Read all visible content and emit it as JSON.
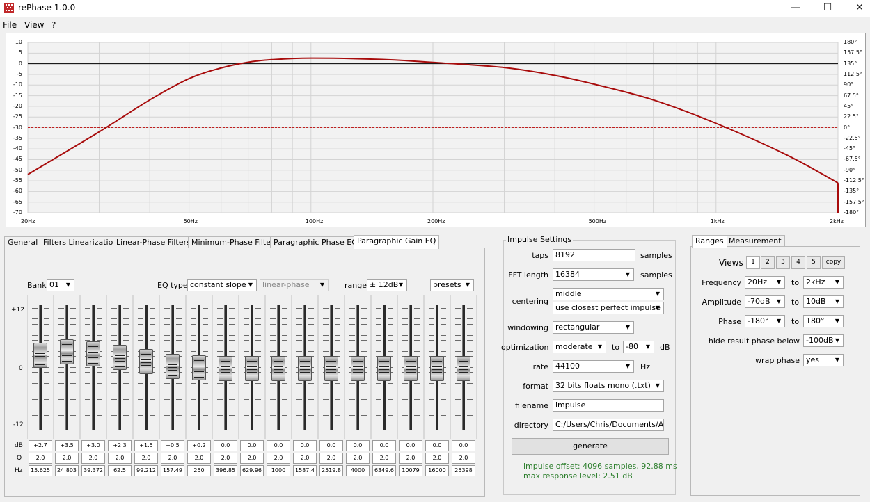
{
  "window": {
    "title": "rePhase 1.0.0",
    "minimize": "—",
    "maximize": "☐",
    "close": "✕"
  },
  "menu": [
    "File",
    "View",
    "?"
  ],
  "plot": {
    "y_left_ticks": [
      "10",
      "5",
      "0",
      "-5",
      "-10",
      "-15",
      "-20",
      "-25",
      "-30",
      "-35",
      "-40",
      "-45",
      "-50",
      "-55",
      "-60",
      "-65",
      "-70"
    ],
    "y_right_ticks": [
      "180°",
      "157.5°",
      "135°",
      "112.5°",
      "90°",
      "67.5°",
      "45°",
      "22.5°",
      "0°",
      "-22.5°",
      "-45°",
      "-67.5°",
      "-90°",
      "-112.5°",
      "-135°",
      "-157.5°",
      "-180°"
    ],
    "x_ticks": [
      "20Hz",
      "50Hz",
      "100Hz",
      "200Hz",
      "500Hz",
      "1kHz",
      "2kHz"
    ],
    "response_color": "#a80c0c",
    "phase_ref_color": "#c02020"
  },
  "chart_data": {
    "type": "line",
    "xlabel": "",
    "ylabel": "",
    "x_scale": "log",
    "xlim": [
      20,
      2000
    ],
    "ylim": [
      -70,
      10
    ],
    "y2lim": [
      -180,
      180
    ],
    "grid": true,
    "series": [
      {
        "x": [
          20,
          30,
          40,
          50,
          60,
          70,
          80,
          100,
          150,
          200,
          300,
          400,
          500,
          700,
          1000,
          1500,
          2000
        ],
        "values": [
          -52,
          -32,
          -17,
          -7,
          -2,
          0.7,
          1.9,
          2.6,
          2.0,
          0.6,
          -1.8,
          -5.5,
          -9.6,
          -17,
          -28,
          -43,
          -56
        ]
      }
    ],
    "zero_phase_line": 0
  },
  "tabs": [
    "General",
    "Filters Linearization",
    "Linear-Phase Filters",
    "Minimum-Phase Filters",
    "Paragraphic Phase EQ",
    "Paragraphic Gain EQ"
  ],
  "eq": {
    "bank_label": "Bank",
    "bank_value": "01",
    "eq_type_label": "EQ type",
    "eq_type_value": "constant slope",
    "eq_type2_value": "linear-phase",
    "range_label": "range",
    "range_value": "± 12dB",
    "presets_value": "presets",
    "scale_top": "+12",
    "scale_mid": "0",
    "scale_bottom": "-12",
    "row_db": "dB",
    "row_q": "Q",
    "row_hz": "Hz",
    "db": [
      "+2.7",
      "+3.5",
      "+3.0",
      "+2.3",
      "+1.5",
      "+0.5",
      "+0.2",
      "0.0",
      "0.0",
      "0.0",
      "0.0",
      "0.0",
      "0.0",
      "0.0",
      "0.0",
      "0.0",
      "0.0"
    ],
    "db_values": [
      2.7,
      3.5,
      3.0,
      2.3,
      1.5,
      0.5,
      0.2,
      0,
      0,
      0,
      0,
      0,
      0,
      0,
      0,
      0,
      0
    ],
    "q": [
      "2.0",
      "2.0",
      "2.0",
      "2.0",
      "2.0",
      "2.0",
      "2.0",
      "2.0",
      "2.0",
      "2.0",
      "2.0",
      "2.0",
      "2.0",
      "2.0",
      "2.0",
      "2.0",
      "2.0"
    ],
    "hz": [
      "15.625",
      "24.803",
      "39.372",
      "62.5",
      "99.212",
      "157.49",
      "250",
      "396.85",
      "629.96",
      "1000",
      "1587.4",
      "2519.8",
      "4000",
      "6349.6",
      "10079",
      "16000",
      "25398"
    ]
  },
  "impulse": {
    "group_title": "Impulse Settings",
    "taps_label": "taps",
    "taps_value": "8192",
    "taps_unit": "samples",
    "fft_label": "FFT length",
    "fft_value": "16384",
    "fft_unit": "samples",
    "centering_label": "centering",
    "centering_value": "middle",
    "centering2_value": "use closest perfect impulse",
    "windowing_label": "windowing",
    "windowing_value": "rectangular",
    "optimization_label": "optimization",
    "optimization_value": "moderate",
    "opt_to": "to",
    "opt_db_value": "-80",
    "opt_db_unit": "dB",
    "rate_label": "rate",
    "rate_value": "44100",
    "rate_unit": "Hz",
    "format_label": "format",
    "format_value": "32 bits floats mono (.txt)",
    "filename_label": "filename",
    "filename_value": "impulse",
    "directory_label": "directory",
    "directory_value": "C:/Users/Chris/Documents/Audio",
    "generate_label": "generate",
    "status_line1": "impulse offset: 4096 samples, 92.88 ms",
    "status_line2": "max response level: 2.51 dB"
  },
  "ranges": {
    "tabs": [
      "Ranges",
      "Measurement"
    ],
    "views_label": "Views",
    "views": [
      "1",
      "2",
      "3",
      "4",
      "5",
      "copy"
    ],
    "frequency_label": "Frequency",
    "freq_from": "20Hz",
    "freq_to": "2kHz",
    "amplitude_label": "Amplitude",
    "amp_from": "-70dB",
    "amp_to": "10dB",
    "phase_label": "Phase",
    "phase_from": "-180°",
    "phase_to": "180°",
    "to": "to",
    "hide_phase_label": "hide result phase below",
    "hide_phase_value": "-100dB",
    "wrap_phase_label": "wrap phase",
    "wrap_phase_value": "yes"
  }
}
